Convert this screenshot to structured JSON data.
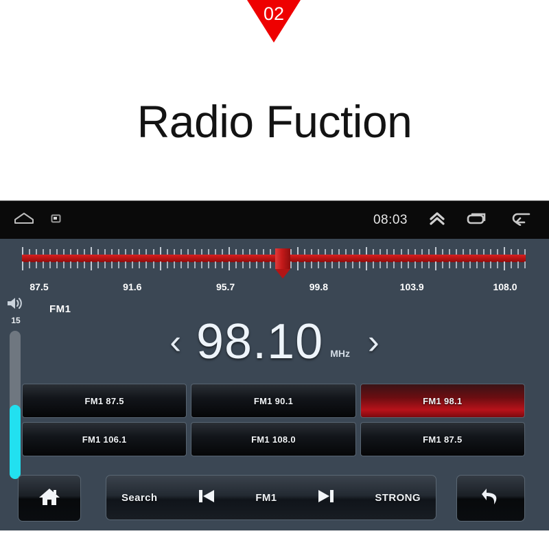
{
  "banner": {
    "badge_number": "02",
    "badge_color": "#ee0000",
    "title": "Radio Fuction"
  },
  "statusbar": {
    "clock": "08:03",
    "left_icons": [
      "home-outline-icon",
      "screenshot-icon"
    ],
    "right_icons": [
      "chevron-double-up-icon",
      "recents-icon",
      "back-arrow-icon"
    ]
  },
  "tuner": {
    "scale_labels": [
      "87.5",
      "91.6",
      "95.7",
      "99.8",
      "103.9",
      "108.0"
    ],
    "scale_min": 87.5,
    "scale_max": 108.0,
    "marker_frequency": 98.1,
    "bar_color": "#b51414"
  },
  "volume": {
    "icon": "speaker-volume-icon",
    "level": "15",
    "fill_color": "#22e0f0"
  },
  "radio": {
    "band": "FM1",
    "frequency": "98.10",
    "unit": "MHz",
    "prev_chevron": "‹",
    "next_chevron": "›"
  },
  "presets": [
    {
      "label": "FM1 87.5",
      "active": false
    },
    {
      "label": "FM1 90.1",
      "active": false
    },
    {
      "label": "FM1 98.1",
      "active": true
    },
    {
      "label": "FM1 106.1",
      "active": false
    },
    {
      "label": "FM1 108.0",
      "active": false
    },
    {
      "label": "FM1 87.5",
      "active": false
    }
  ],
  "bottombar": {
    "home_icon": "home-icon",
    "back_icon": "undo-arrow-icon",
    "search_label": "Search",
    "prev_icon": "skip-previous-icon",
    "band_label": "FM1",
    "next_icon": "skip-next-icon",
    "strength_label": "STRONG"
  }
}
